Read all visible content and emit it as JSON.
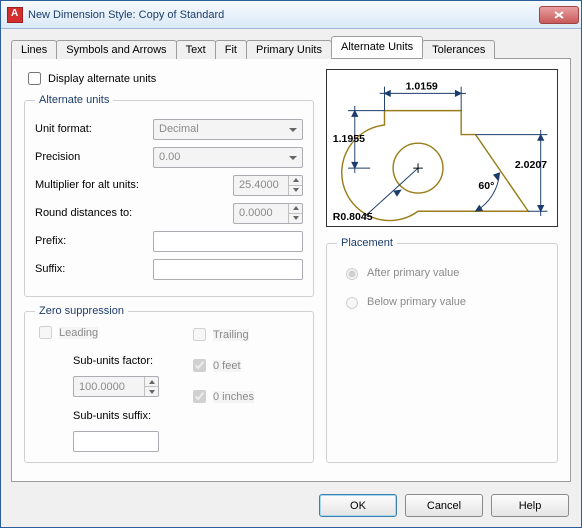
{
  "title": "New Dimension Style: Copy of Standard",
  "tabs": [
    "Lines",
    "Symbols and Arrows",
    "Text",
    "Fit",
    "Primary Units",
    "Alternate Units",
    "Tolerances"
  ],
  "active_tab": "Alternate Units",
  "display_alt": {
    "label": "Display alternate units",
    "checked": false
  },
  "alt_units": {
    "legend": "Alternate units",
    "unit_format": {
      "label": "Unit format:",
      "value": "Decimal"
    },
    "precision": {
      "label": "Precision",
      "value": "0.00"
    },
    "multiplier": {
      "label": "Multiplier for alt units:",
      "value": "25.4000"
    },
    "round": {
      "label": "Round distances  to:",
      "value": "0.0000"
    },
    "prefix": {
      "label": "Prefix:",
      "value": ""
    },
    "suffix": {
      "label": "Suffix:",
      "value": ""
    }
  },
  "zero": {
    "legend": "Zero suppression",
    "leading": {
      "label": "Leading",
      "checked": false
    },
    "trailing": {
      "label": "Trailing",
      "checked": false
    },
    "feet": {
      "label": "0 feet",
      "checked": true
    },
    "inches": {
      "label": "0 inches",
      "checked": true
    },
    "sub_factor": {
      "label": "Sub-units factor:",
      "value": "100.0000"
    },
    "sub_suffix": {
      "label": "Sub-units suffix:",
      "value": ""
    }
  },
  "preview": {
    "dim_top": "1.0159",
    "dim_left": "1.1955",
    "dim_right": "2.0207",
    "dim_angle": "60°",
    "dim_radius": "R0.8045"
  },
  "placement": {
    "legend": "Placement",
    "after": "After primary value",
    "below": "Below primary value",
    "selected": "after"
  },
  "buttons": {
    "ok": "OK",
    "cancel": "Cancel",
    "help": "Help"
  }
}
